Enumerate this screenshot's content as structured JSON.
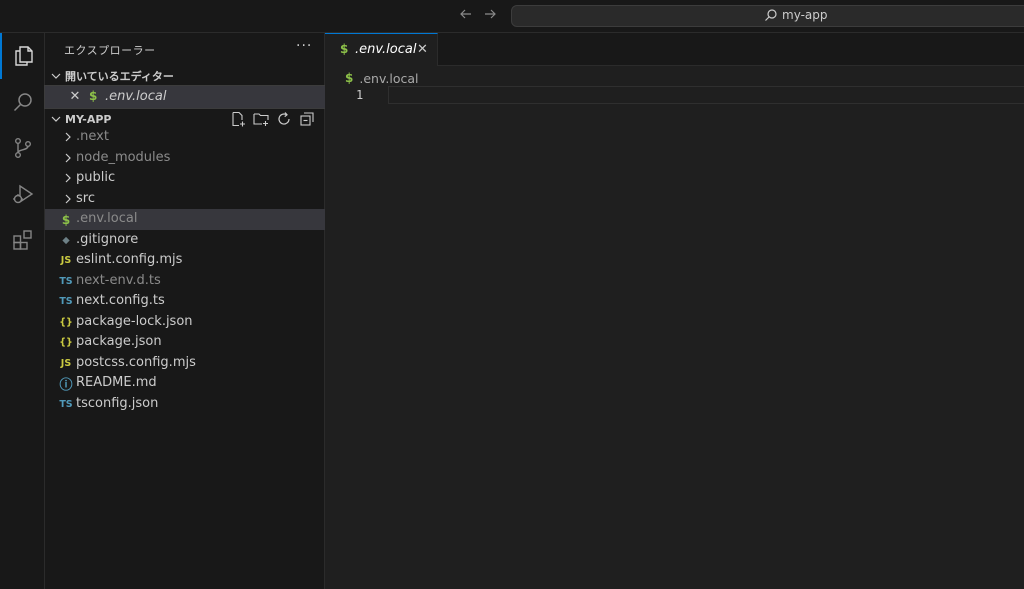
{
  "titlebar": {
    "back_icon": "arrow-left-icon",
    "forward_icon": "arrow-right-icon",
    "search_text": "my-app"
  },
  "activitybar": {
    "items": [
      "explorer-icon",
      "search-icon",
      "source-control-icon",
      "run-debug-icon",
      "extensions-icon"
    ]
  },
  "sidebar": {
    "title": "エクスプローラー",
    "more": "···",
    "open_editors": {
      "label": "開いているエディター",
      "items": [
        {
          "close": "✕",
          "icon": "$",
          "label": ".env.local"
        }
      ]
    },
    "folder": {
      "label": "MY-APP",
      "items": [
        {
          "type": "folder",
          "label": ".next",
          "dim": true
        },
        {
          "type": "folder",
          "label": "node_modules",
          "dim": true
        },
        {
          "type": "folder",
          "label": "public",
          "dim": false
        },
        {
          "type": "folder",
          "label": "src",
          "dim": false
        },
        {
          "type": "file",
          "icon": "$",
          "label": ".env.local",
          "dim": true,
          "selected": true
        },
        {
          "type": "file",
          "icon": "◆",
          "label": ".gitignore",
          "dim": false
        },
        {
          "type": "file",
          "icon": "JS",
          "label": "eslint.config.mjs",
          "dim": false
        },
        {
          "type": "file",
          "icon": "TS",
          "label": "next-env.d.ts",
          "dim": true
        },
        {
          "type": "file",
          "icon": "TS",
          "label": "next.config.ts",
          "dim": false
        },
        {
          "type": "file",
          "icon": "{}",
          "label": "package-lock.json",
          "dim": false
        },
        {
          "type": "file",
          "icon": "{}",
          "label": "package.json",
          "dim": false
        },
        {
          "type": "file",
          "icon": "JS",
          "label": "postcss.config.mjs",
          "dim": false
        },
        {
          "type": "file",
          "icon": "ⓘ",
          "label": "README.md",
          "dim": false
        },
        {
          "type": "file",
          "icon": "TS",
          "label": "tsconfig.json",
          "dim": false
        }
      ]
    }
  },
  "editor": {
    "tab": {
      "icon": "$",
      "label": ".env.local",
      "close": "✕"
    },
    "breadcrumb": {
      "icon": "$",
      "label": ".env.local"
    },
    "line_number": "1"
  },
  "colors": {
    "accent": "#0078d4",
    "env_icon": "#8dc149",
    "js_icon": "#cbcb41",
    "ts_icon": "#519aba",
    "json_icon": "#cbcb41",
    "info_icon": "#519aba",
    "git_icon": "#6d8086"
  }
}
